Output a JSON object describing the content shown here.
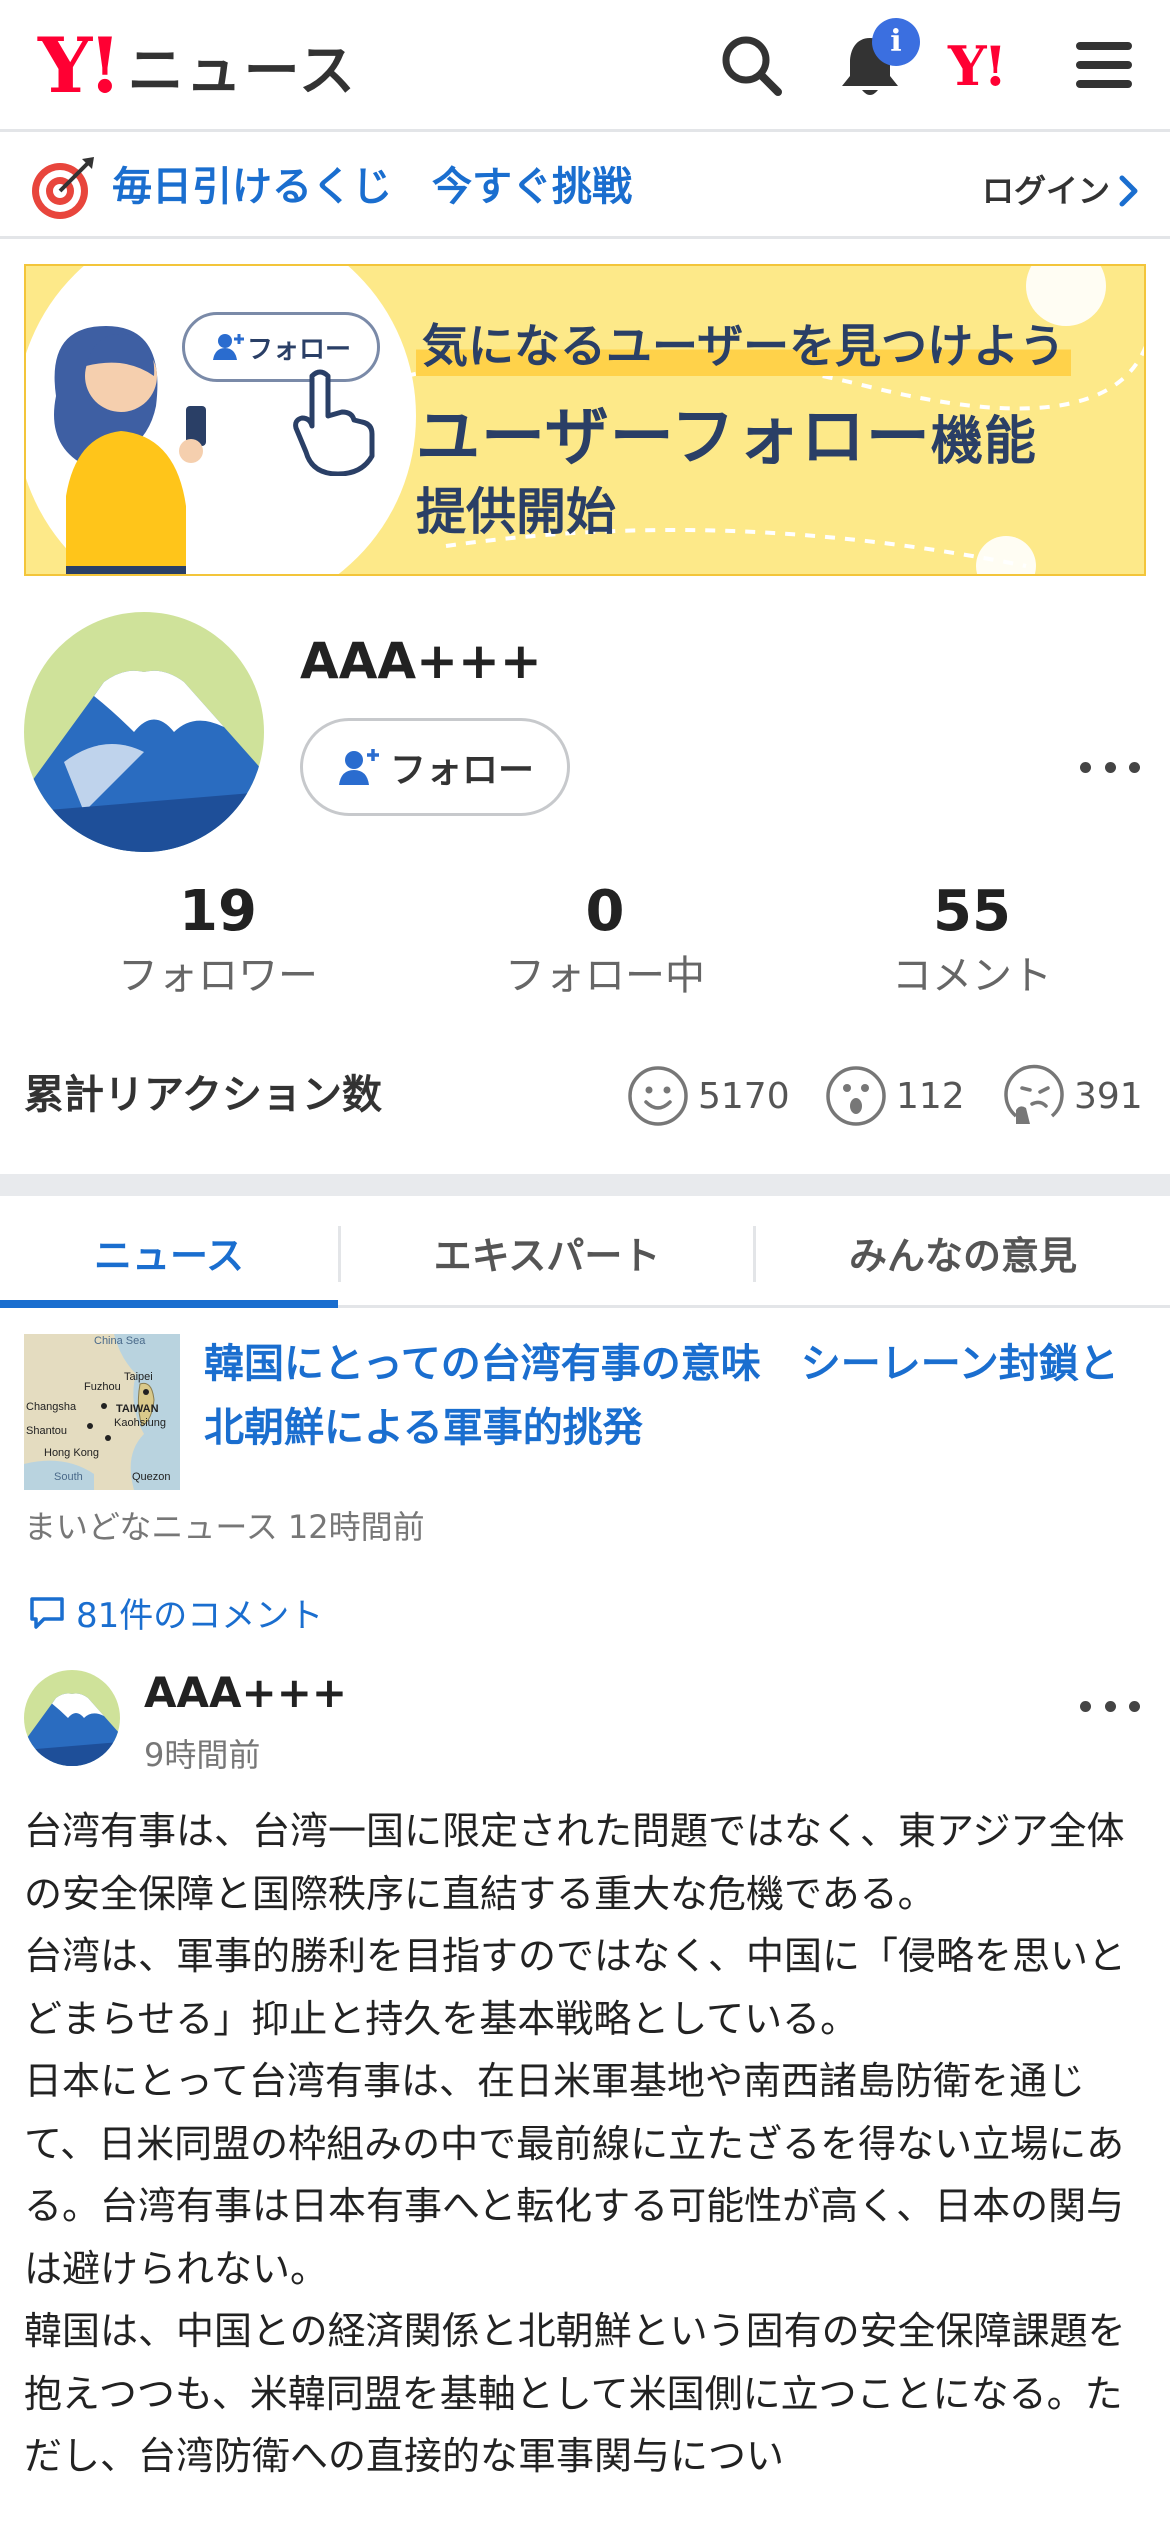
{
  "header": {
    "logo_mark": "Y!",
    "logo_text": "ニュース",
    "notification_badge": "i",
    "yahoo_mark": "Y!"
  },
  "lottery": {
    "text": "毎日引けるくじ　今すぐ挑戦",
    "login_label": "ログイン"
  },
  "banner": {
    "follow_chip": "フォロー",
    "line1": "気になるユーザーを見つけよう",
    "line2_main": "ユーザーフォロー",
    "line2_small": "機能",
    "line3": "提供開始"
  },
  "profile": {
    "username": "AAA+++",
    "follow_button": "フォロー"
  },
  "stats": [
    {
      "value": "19",
      "label": "フォロワー"
    },
    {
      "value": "0",
      "label": "フォロー中"
    },
    {
      "value": "55",
      "label": "コメント"
    }
  ],
  "reactions": {
    "label": "累計リアクション数",
    "items": [
      {
        "icon": "smile-face-icon",
        "count": "5170"
      },
      {
        "icon": "surprised-face-icon",
        "count": "112"
      },
      {
        "icon": "thinking-face-icon",
        "count": "391"
      }
    ]
  },
  "tabs": [
    {
      "label": "ニュース",
      "active": true
    },
    {
      "label": "エキスパート",
      "active": false
    },
    {
      "label": "みんなの意見",
      "active": false
    }
  ],
  "article": {
    "title": "韓国にとっての台湾有事の意味　シーレーン封鎖と北朝鮮による軍事的挑発",
    "source": "まいどなニュース 12時間前",
    "comments_link": "81件のコメント",
    "thumb_labels": [
      "China Sea",
      "Fuzhou",
      "Taipei",
      "TAIWAN",
      "Kaohsiung",
      "Changsha",
      "Shantou",
      "Hong Kong",
      "South",
      "Quezon"
    ]
  },
  "comment": {
    "username": "AAA+++",
    "time": "9時間前",
    "body": "台湾有事は、台湾一国に限定された問題ではなく、東アジア全体の安全保障と国際秩序に直結する重大な危機である。\n台湾は、軍事的勝利を目指すのではなく、中国に「侵略を思いとどまらせる」抑止と持久を基本戦略としている。\n日本にとって台湾有事は、在日米軍基地や南西諸島防衛を通じて、日米同盟の枠組みの中で最前線に立たざるを得ない立場にある。台湾有事は日本有事へと転化する可能性が高く、日本の関与は避けられない。\n韓国は、中国との経済関係と北朝鮮という固有の安全保障課題を抱えつつも、米韓同盟を基軸として米国側に立つことになる。ただし、台湾防衛への直接的な軍事関与につい"
  },
  "colors": {
    "accent_blue": "#1a6ecf",
    "yahoo_red": "#ff0033",
    "banner_yellow": "#fde989"
  }
}
